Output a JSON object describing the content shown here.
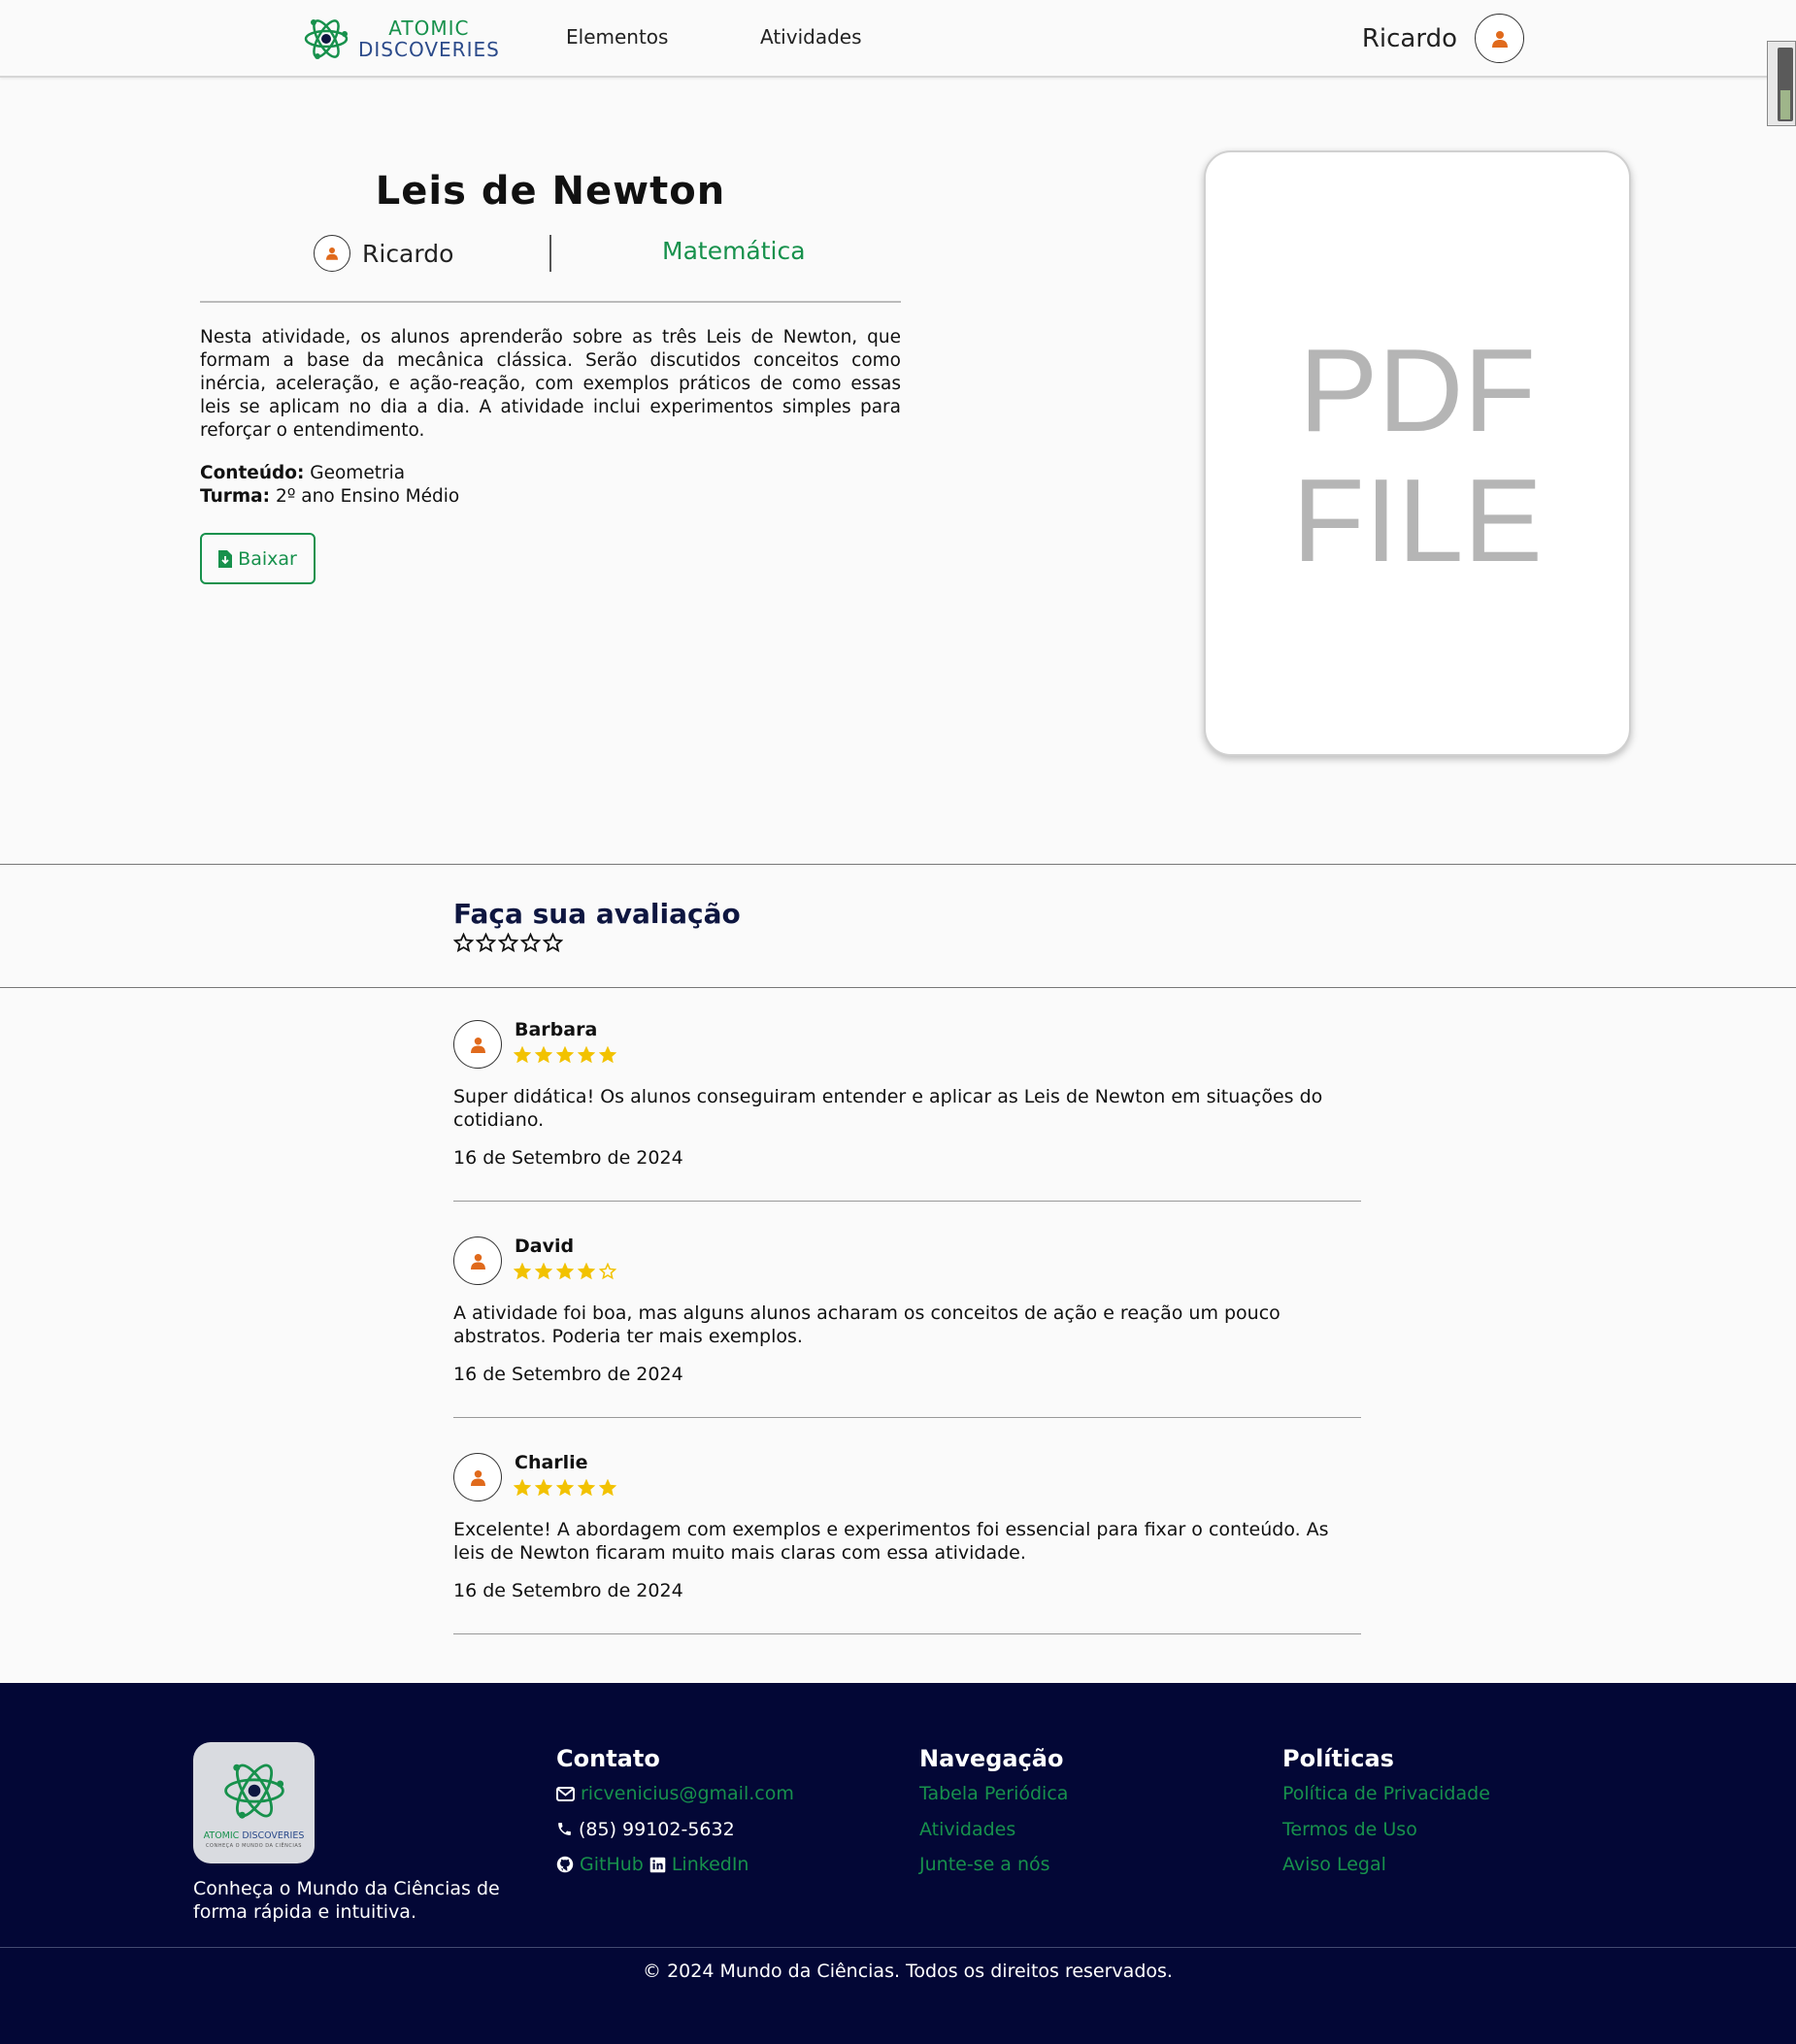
{
  "header": {
    "logo_line1": "ATOMIC",
    "logo_line2": "DISCOVERIES",
    "nav": [
      "Elementos",
      "Atividades"
    ],
    "user_name": "Ricardo"
  },
  "activity": {
    "title": "Leis de Newton",
    "author": "Ricardo",
    "subject": "Matemática",
    "description": "Nesta atividade, os alunos aprenderão sobre as três Leis de Newton, que formam a base da mecânica clássica. Serão discutidos conceitos como inércia, aceleração, e ação-reação, com exemplos práticos de como essas leis se aplicam no dia a dia. A atividade inclui experimentos simples para reforçar o entendimento.",
    "content_label": "Conteúdo:",
    "content_value": "Geometria",
    "class_label": "Turma:",
    "class_value": "2º ano Ensino Médio",
    "download_label": "Baixar",
    "pdf_line1": "PDF",
    "pdf_line2": "FILE"
  },
  "rating": {
    "title": "Faça sua avaliação",
    "max_stars": 5,
    "selected": 0
  },
  "reviews": [
    {
      "name": "Barbara",
      "stars": 5,
      "text": "Super didática! Os alunos conseguiram entender e aplicar as Leis de Newton em situações do cotidiano.",
      "date": "16 de Setembro de 2024"
    },
    {
      "name": "David",
      "stars": 4,
      "text": "A atividade foi boa, mas alguns alunos acharam os conceitos de ação e reação um pouco abstratos. Poderia ter mais exemplos.",
      "date": "16 de Setembro de 2024"
    },
    {
      "name": "Charlie",
      "stars": 5,
      "text": "Excelente! A abordagem com exemplos e experimentos foi essencial para fixar o conteúdo. As leis de Newton ficaram muito mais claras com essa atividade.",
      "date": "16 de Setembro de 2024"
    }
  ],
  "footer": {
    "logo_line1a": "ATOMIC",
    "logo_line1b": "DISCOVERIES",
    "logo_line2": "CONHEÇA O MUNDO DA CIÊNCIAS",
    "tagline": "Conheça o Mundo da Ciências de forma rápida e intuitiva.",
    "contact": {
      "title": "Contato",
      "email": "ricvenicius@gmail.com",
      "phone": "(85) 99102-5632",
      "github": "GitHub",
      "linkedin": "LinkedIn"
    },
    "navigation": {
      "title": "Navegação",
      "links": [
        "Tabela Periódica",
        "Atividades",
        "Junte-se a nós"
      ]
    },
    "policies": {
      "title": "Políticas",
      "links": [
        "Política de Privacidade",
        "Termos de Uso",
        "Aviso Legal"
      ]
    },
    "copyright": "© 2024 Mundo da Ciências. Todos os direitos reservados."
  },
  "colors": {
    "brand_green": "#17914c",
    "brand_blue": "#2b4a8a",
    "footer_bg": "#030736",
    "star_gold": "#f2c200",
    "avatar_orange": "#e06a1c"
  }
}
